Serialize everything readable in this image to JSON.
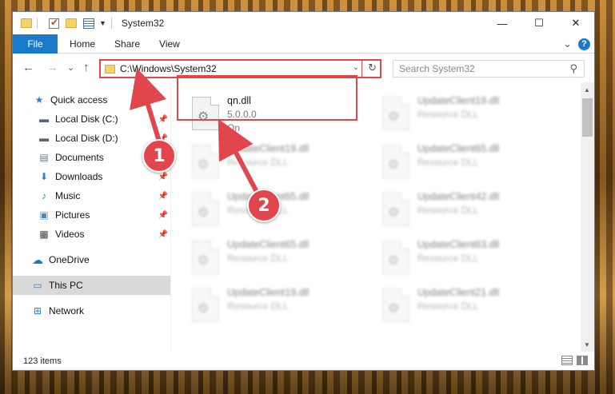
{
  "window": {
    "title": "System32",
    "minimize_glyph": "—",
    "maximize_glyph": "☐",
    "close_glyph": "✕"
  },
  "ribbon": {
    "file_tab": "File",
    "tabs": [
      "Home",
      "Share",
      "View"
    ],
    "expand_glyph": "⌄",
    "help_glyph": "?"
  },
  "navigation": {
    "back_glyph": "←",
    "forward_glyph": "→",
    "recent_glyph": "⌄",
    "up_glyph": "↑"
  },
  "address": {
    "path": "C:\\Windows\\System32",
    "dropdown_glyph": "⌄",
    "refresh_glyph": "↻"
  },
  "search": {
    "placeholder": "Search System32",
    "icon_glyph": "⚲"
  },
  "nav_pane": {
    "items": [
      {
        "label": "Quick access",
        "icon": "star-icon",
        "glyph": "★",
        "pinned": false
      },
      {
        "label": "Local Disk (C:)",
        "icon": "drive-icon",
        "glyph": "▬",
        "pinned": true
      },
      {
        "label": "Local Disk (D:)",
        "icon": "drive-icon",
        "glyph": "▬",
        "pinned": true
      },
      {
        "label": "Documents",
        "icon": "documents-icon",
        "glyph": "▤",
        "pinned": true
      },
      {
        "label": "Downloads",
        "icon": "download-icon",
        "glyph": "⬇",
        "pinned": true
      },
      {
        "label": "Music",
        "icon": "music-icon",
        "glyph": "♪",
        "pinned": true
      },
      {
        "label": "Pictures",
        "icon": "pictures-icon",
        "glyph": "▣",
        "pinned": true
      },
      {
        "label": "Videos",
        "icon": "videos-icon",
        "glyph": "▦",
        "pinned": true
      },
      {
        "label": "OneDrive",
        "icon": "cloud-icon",
        "glyph": "☁",
        "pinned": false
      },
      {
        "label": "This PC",
        "icon": "computer-icon",
        "glyph": "▭",
        "pinned": false,
        "selected": true
      },
      {
        "label": "Network",
        "icon": "network-icon",
        "glyph": "⊞",
        "pinned": false
      }
    ],
    "pin_glyph": "📌"
  },
  "files": [
    {
      "name": "qn.dll",
      "line2": "5.0.0.0",
      "line3": "Qn",
      "blurred": false
    },
    {
      "name": "UpdateClient19.dll",
      "line2": "Resource DLL",
      "blurred": true
    },
    {
      "name": "UpdateClient19.dll",
      "line2": "Resource DLL",
      "blurred": true
    },
    {
      "name": "UpdateClient65.dll",
      "line2": "Resource DLL",
      "blurred": true
    },
    {
      "name": "UpdateClient65.dll",
      "line2": "Resource DLL",
      "blurred": true
    },
    {
      "name": "UpdateClient42.dll",
      "line2": "Resource DLL",
      "blurred": true
    },
    {
      "name": "UpdateClient65.dll",
      "line2": "Resource DLL",
      "blurred": true
    },
    {
      "name": "UpdateClient63.dll",
      "line2": "Resource DLL",
      "blurred": true
    },
    {
      "name": "UpdateClient19.dll",
      "line2": "Resource DLL",
      "blurred": true
    },
    {
      "name": "UpdateClient21.dll",
      "line2": "Resource DLL",
      "blurred": true
    }
  ],
  "status": {
    "item_count": "123 items"
  },
  "annotations": {
    "step1": "1",
    "step2": "2",
    "color": "#e0464b"
  },
  "colors": {
    "accent": "#1979ca",
    "highlight": "#e0464b",
    "selected_nav": "#d9d9d9"
  }
}
